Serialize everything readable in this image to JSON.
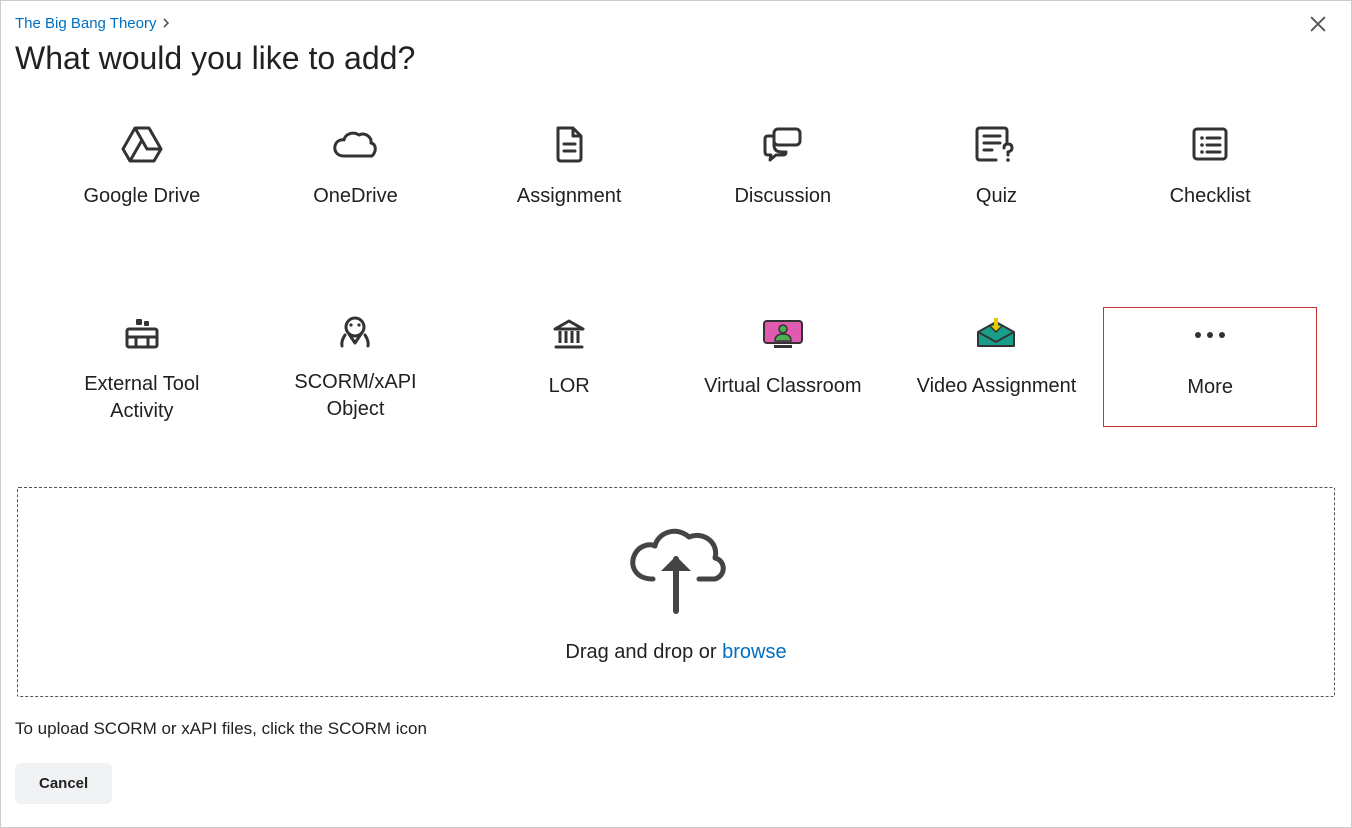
{
  "breadcrumb": {
    "course": "The Big Bang Theory"
  },
  "title": "What would you like to add?",
  "tiles": {
    "google_drive": "Google Drive",
    "onedrive": "OneDrive",
    "assignment": "Assignment",
    "discussion": "Discussion",
    "quiz": "Quiz",
    "checklist": "Checklist",
    "external_tool": "External Tool Activity",
    "scorm": "SCORM/xAPI Object",
    "lor": "LOR",
    "virtual_classroom": "Virtual Classroom",
    "video_assignment": "Video Assignment",
    "more": "More"
  },
  "dropzone": {
    "prefix": "Drag and drop or ",
    "link": "browse"
  },
  "help": "To upload SCORM or xAPI files, click the SCORM icon",
  "cancel": "Cancel"
}
